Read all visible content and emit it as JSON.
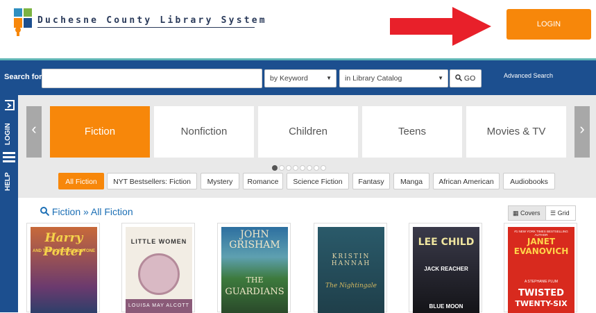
{
  "header": {
    "logo_text": "Duchesne County Library System",
    "logo_badge": "4-H",
    "login_label": "LOGIN"
  },
  "search": {
    "label": "Search for",
    "input_value": "",
    "by_select": "by Keyword",
    "scope_select": "in Library Catalog",
    "go_label": "GO",
    "advanced_label": "Advanced Search"
  },
  "sidebar": {
    "login_label": "LOGIN",
    "help_label": "HELP"
  },
  "carousel": {
    "prev": "‹",
    "next": "›",
    "categories": [
      "Fiction",
      "Nonfiction",
      "Children",
      "Teens",
      "Movies & TV"
    ],
    "active_index": 0,
    "dot_count": 8,
    "active_dot": 0
  },
  "subnav": {
    "items": [
      "All Fiction",
      "NYT Bestsellers: Fiction",
      "Mystery",
      "Romance",
      "Science Fiction",
      "Fantasy",
      "Manga",
      "African American",
      "Audiobooks"
    ],
    "active_index": 0
  },
  "results": {
    "title": "Fiction » All Fiction",
    "covers_label": "Covers",
    "grid_label": "Grid"
  },
  "books": [
    {
      "title_line1": "Harry Potter",
      "title_line2": "AND THE SORCERER'S STONE"
    },
    {
      "title_line1": "LITTLE WOMEN",
      "author": "LOUISA MAY ALCOTT"
    },
    {
      "author": "JOHN GRISHAM",
      "title_line1": "THE",
      "title_line2": "GUARDIANS"
    },
    {
      "author": "KRISTIN HANNAH",
      "title_line1": "The Nightingale"
    },
    {
      "author": "LEE CHILD",
      "series": "JACK REACHER",
      "title_line1": "BLUE MOON"
    },
    {
      "tagline": "#1 NEW YORK TIMES BESTSELLING AUTHOR",
      "author": "JANET EVANOVICH",
      "series": "A STEPHANIE PLUM",
      "title_line1": "TWISTED",
      "title_line2": "TWENTY-SIX"
    }
  ],
  "colors": {
    "brand_blue": "#1c4f8f",
    "accent_orange": "#f7870a",
    "teal": "#5fb5b5"
  }
}
